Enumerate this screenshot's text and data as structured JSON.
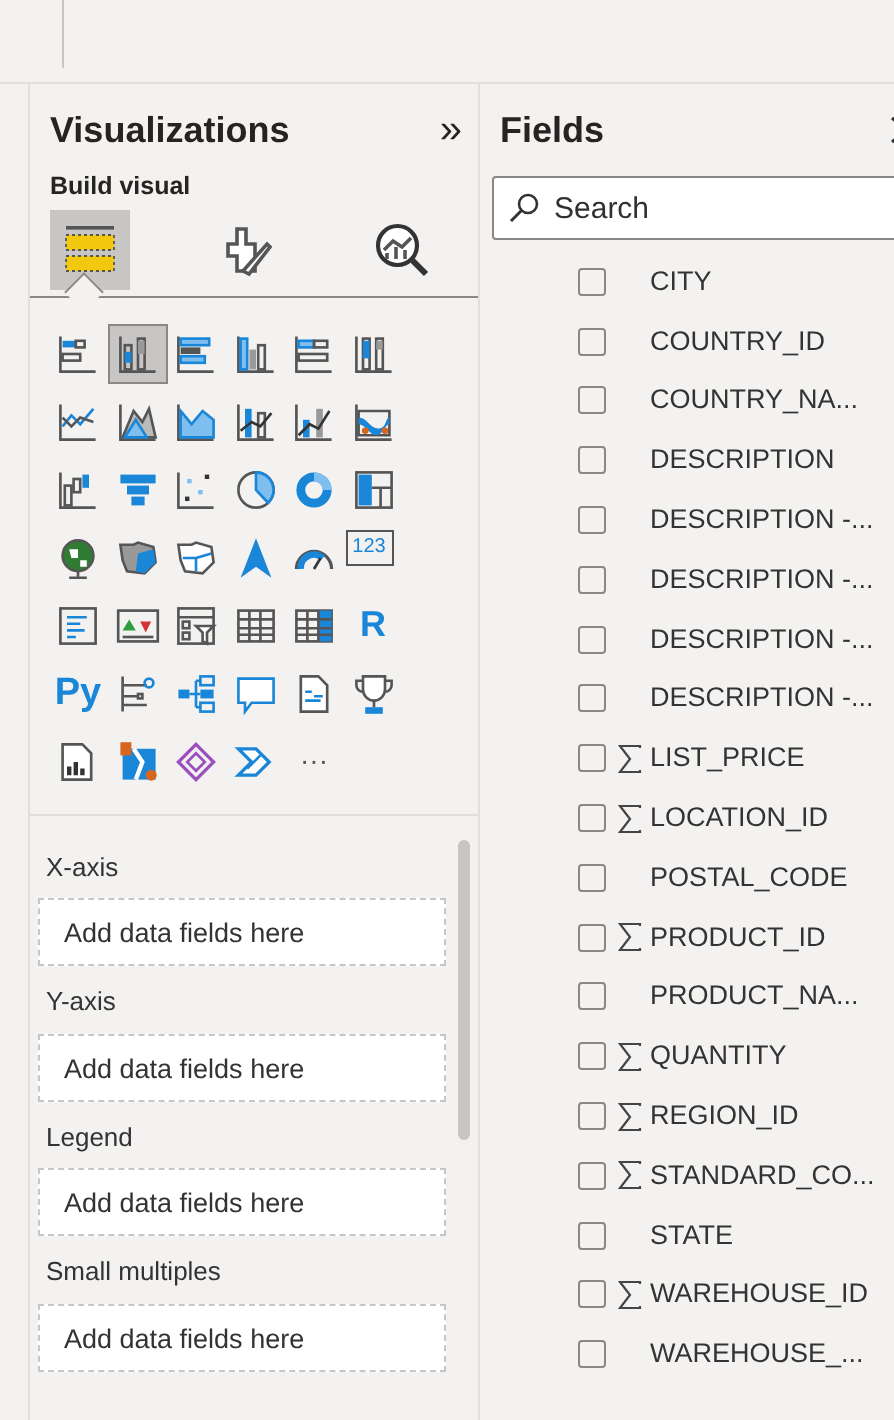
{
  "visualizations": {
    "title": "Visualizations",
    "collapse": "»",
    "subtitle": "Build visual",
    "tabs": [
      {
        "kind": "fields",
        "selected": true
      },
      {
        "kind": "format",
        "selected": false
      },
      {
        "kind": "analytics",
        "selected": false
      }
    ],
    "visuals": [
      {
        "kind": "stacked-bar",
        "selected": false
      },
      {
        "kind": "stacked-column",
        "selected": true
      },
      {
        "kind": "clustered-bar",
        "selected": false
      },
      {
        "kind": "clustered-column",
        "selected": false
      },
      {
        "kind": "stacked-bar-100",
        "selected": false
      },
      {
        "kind": "stacked-column-100",
        "selected": false
      },
      {
        "kind": "line",
        "selected": false
      },
      {
        "kind": "area",
        "selected": false
      },
      {
        "kind": "stacked-area",
        "selected": false
      },
      {
        "kind": "line-column",
        "selected": false
      },
      {
        "kind": "line-column-2",
        "selected": false
      },
      {
        "kind": "ribbon",
        "selected": false
      },
      {
        "kind": "waterfall",
        "selected": false
      },
      {
        "kind": "funnel",
        "selected": false
      },
      {
        "kind": "scatter",
        "selected": false
      },
      {
        "kind": "pie",
        "selected": false
      },
      {
        "kind": "donut",
        "selected": false
      },
      {
        "kind": "treemap",
        "selected": false
      },
      {
        "kind": "globe",
        "selected": false
      },
      {
        "kind": "filled-map",
        "selected": false
      },
      {
        "kind": "shape-map",
        "selected": false
      },
      {
        "kind": "navigation",
        "selected": false
      },
      {
        "kind": "gauge",
        "selected": false
      },
      {
        "kind": "card",
        "label": "123",
        "selected": false
      },
      {
        "kind": "multi-row-card",
        "selected": false
      },
      {
        "kind": "kpi",
        "selected": false
      },
      {
        "kind": "slicer",
        "selected": false
      },
      {
        "kind": "table",
        "selected": false
      },
      {
        "kind": "matrix",
        "selected": false
      },
      {
        "kind": "text",
        "label": "R",
        "selected": false
      },
      {
        "kind": "text",
        "label": "Py",
        "selected": false
      },
      {
        "kind": "influencers",
        "selected": false
      },
      {
        "kind": "tree",
        "selected": false
      },
      {
        "kind": "speech",
        "selected": false
      },
      {
        "kind": "narrative",
        "selected": false
      },
      {
        "kind": "trophy",
        "selected": false
      },
      {
        "kind": "report",
        "selected": false
      },
      {
        "kind": "arcgis",
        "selected": false
      },
      {
        "kind": "diamond",
        "selected": false
      },
      {
        "kind": "automate",
        "selected": false
      },
      {
        "kind": "more",
        "label": "···",
        "selected": false
      }
    ],
    "wells": [
      {
        "label": "X-axis",
        "placeholder": "Add data fields here"
      },
      {
        "label": "Y-axis",
        "placeholder": "Add data fields here"
      },
      {
        "label": "Legend",
        "placeholder": "Add data fields here"
      },
      {
        "label": "Small multiples",
        "placeholder": "Add data fields here"
      }
    ]
  },
  "fields": {
    "title": "Fields",
    "search": {
      "placeholder": "Search"
    },
    "items": [
      {
        "name": "CITY",
        "checked": false,
        "numeric": false
      },
      {
        "name": "COUNTRY_ID",
        "checked": false,
        "numeric": false
      },
      {
        "name": "COUNTRY_NA...",
        "checked": false,
        "numeric": false
      },
      {
        "name": "DESCRIPTION",
        "checked": false,
        "numeric": false
      },
      {
        "name": "DESCRIPTION -...",
        "checked": false,
        "numeric": false
      },
      {
        "name": "DESCRIPTION -...",
        "checked": false,
        "numeric": false
      },
      {
        "name": "DESCRIPTION -...",
        "checked": false,
        "numeric": false
      },
      {
        "name": "DESCRIPTION -...",
        "checked": false,
        "numeric": false
      },
      {
        "name": "LIST_PRICE",
        "checked": false,
        "numeric": true
      },
      {
        "name": "LOCATION_ID",
        "checked": false,
        "numeric": true
      },
      {
        "name": "POSTAL_CODE",
        "checked": false,
        "numeric": false
      },
      {
        "name": "PRODUCT_ID",
        "checked": false,
        "numeric": true
      },
      {
        "name": "PRODUCT_NA...",
        "checked": false,
        "numeric": false
      },
      {
        "name": "QUANTITY",
        "checked": false,
        "numeric": true
      },
      {
        "name": "REGION_ID",
        "checked": false,
        "numeric": true
      },
      {
        "name": "STANDARD_CO...",
        "checked": false,
        "numeric": true
      },
      {
        "name": "STATE",
        "checked": false,
        "numeric": false
      },
      {
        "name": "WAREHOUSE_ID",
        "checked": false,
        "numeric": true
      },
      {
        "name": "WAREHOUSE_...",
        "checked": false,
        "numeric": false
      }
    ]
  }
}
